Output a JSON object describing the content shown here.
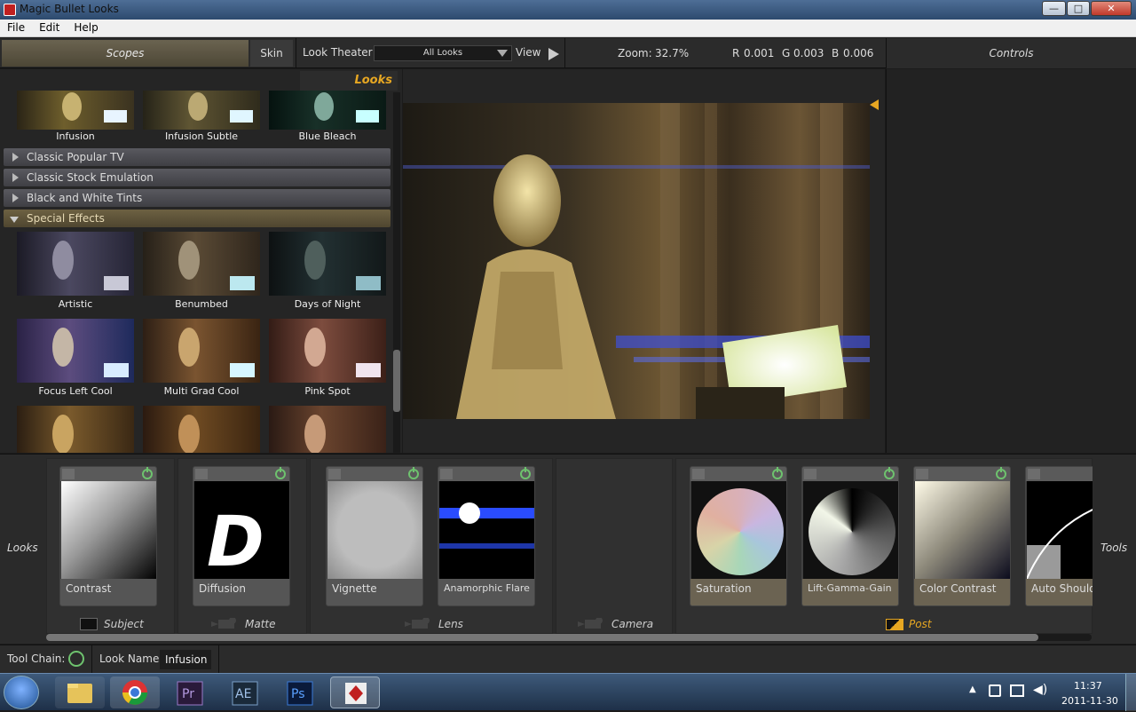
{
  "window": {
    "title": "Magic Bullet Looks",
    "buttons": {
      "minimize": "—",
      "maximize": "□",
      "close": "✕"
    }
  },
  "menu": [
    "File",
    "Edit",
    "Help"
  ],
  "toolbar": {
    "scopes_tab": "Scopes",
    "skin_tab": "Skin",
    "look_theater_label": "Look Theater",
    "look_theater_value": "All Looks",
    "view_label": "View",
    "zoom_label": "Zoom:",
    "zoom_value": "32.7%",
    "r_label": "R",
    "r_value": "0.001",
    "g_label": "G",
    "g_value": "0.003",
    "b_label": "B",
    "b_value": "0.006",
    "controls_tab": "Controls"
  },
  "looks_panel": {
    "header": "Looks",
    "top_row": [
      "Infusion",
      "Infusion Subtle",
      "Blue Bleach"
    ],
    "categories": [
      "Classic Popular TV",
      "Classic Stock Emulation",
      "Black and White Tints",
      "Special Effects"
    ],
    "special_effects_row1": [
      "Artistic",
      "Benumbed",
      "Days of Night"
    ],
    "special_effects_row2": [
      "Focus Left Cool",
      "Multi Grad Cool",
      "Pink Spot"
    ]
  },
  "tool_chain": {
    "side_left": "Looks",
    "side_right": "Tools",
    "tools": [
      {
        "name": "Contrast",
        "group": "subject"
      },
      {
        "name": "Diffusion",
        "group": "matte"
      },
      {
        "name": "Vignette",
        "group": "lens"
      },
      {
        "name": "Anamorphic Flare",
        "group": "lens"
      },
      {
        "name": "Saturation",
        "group": "post"
      },
      {
        "name": "Lift-Gamma-Gain",
        "group": "post"
      },
      {
        "name": "Color Contrast",
        "group": "post"
      },
      {
        "name": "Auto Should",
        "group": "post"
      }
    ],
    "groups": [
      "Subject",
      "Matte",
      "Lens",
      "Camera",
      "Post"
    ],
    "diffusion_letter": "D"
  },
  "status": {
    "tool_chain_label": "Tool Chain:",
    "look_name_label": "Look Name:",
    "look_name_value": "Infusion"
  },
  "taskbar": {
    "apps": [
      "Explorer",
      "Chrome",
      "Pr",
      "Ae",
      "Ps",
      "Magic Bullet Looks"
    ],
    "time": "11:37",
    "date": "2011-11-30"
  },
  "colors": {
    "accent": "#e7a722",
    "power_green": "#6ec26e",
    "active_category": "#6d6142"
  }
}
